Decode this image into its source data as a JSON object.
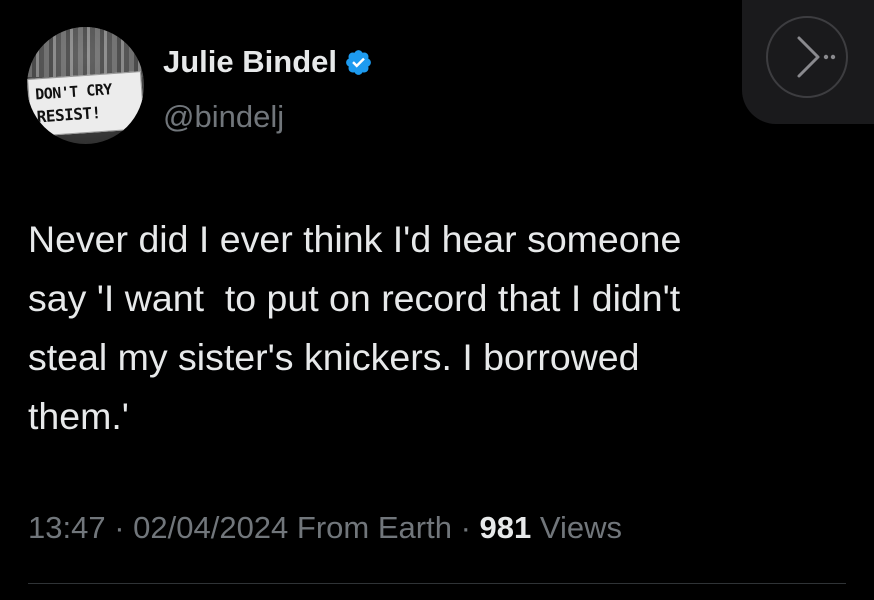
{
  "author": {
    "display_name": "Julie Bindel",
    "handle": "@bindelj",
    "verified": true,
    "avatar_sign": {
      "line1": "DON'T CRY",
      "line2": "RESIST!"
    }
  },
  "tweet": {
    "text": "Never did I ever think I'd hear someone\nsay 'I want  to put on record that I didn't\nsteal my sister's knickers. I borrowed\nthem.'"
  },
  "meta": {
    "time": "13:47",
    "separator": " · ",
    "date": "02/04/2024",
    "source": "From Earth",
    "views_count": "981",
    "views_label": "Views"
  },
  "icons": {
    "verified": "verified-badge-icon",
    "share": "chevron-right-icon"
  },
  "colors": {
    "background": "#000000",
    "primary_text": "#e7e9ea",
    "secondary_text": "#71767b",
    "verified_blue": "#1d9bf0"
  }
}
